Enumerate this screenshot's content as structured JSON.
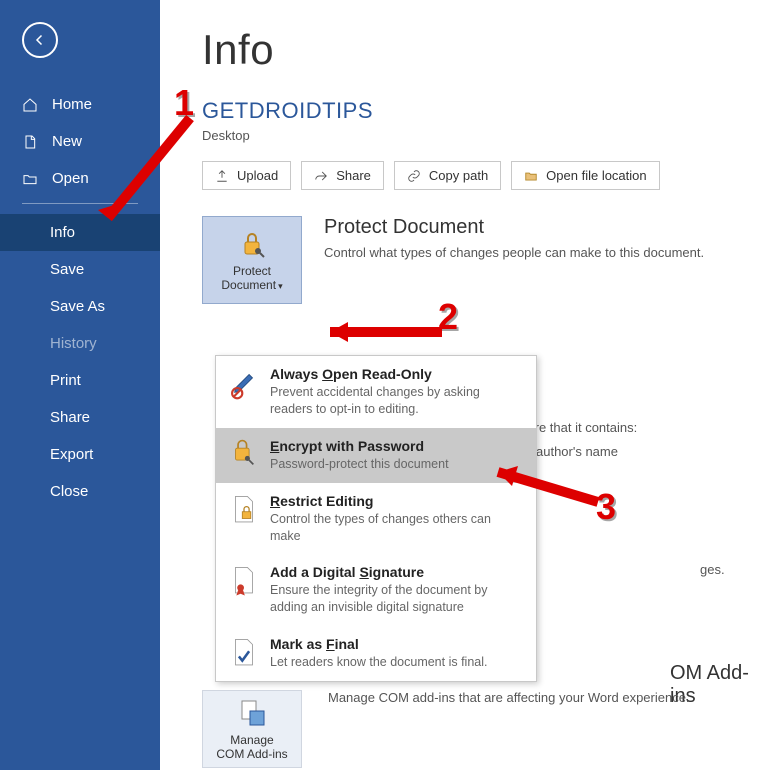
{
  "sidebar": {
    "items": [
      {
        "label": "Home",
        "icon": "home"
      },
      {
        "label": "New",
        "icon": "doc"
      },
      {
        "label": "Open",
        "icon": "folder"
      }
    ],
    "items2": [
      {
        "label": "Info",
        "selected": true
      },
      {
        "label": "Save"
      },
      {
        "label": "Save As"
      },
      {
        "label": "History",
        "disabled": true
      },
      {
        "label": "Print"
      },
      {
        "label": "Share"
      },
      {
        "label": "Export"
      },
      {
        "label": "Close"
      }
    ]
  },
  "page": {
    "title": "Info",
    "docTitle": "GETDROIDTIPS",
    "docLocation": "Desktop"
  },
  "toolbar": {
    "upload": "Upload",
    "share": "Share",
    "copy": "Copy path",
    "openloc": "Open file location"
  },
  "protect": {
    "btn_l1": "Protect",
    "btn_l2": "Document",
    "heading": "Protect Document",
    "desc": "Control what types of changes people can make to this document."
  },
  "inspect": {
    "heading_partial": "ware that it contains:",
    "bullet1": "author's name"
  },
  "addins": {
    "heading_fragment": "OM Add-ins",
    "desc_fragment": "Manage COM add-ins that are affecting your Word experience.",
    "btn_l1": "Manage",
    "btn_l2": "COM Add-ins"
  },
  "changes_fragment": "ges.",
  "dropdown": [
    {
      "title": "Always Open Read-Only",
      "desc": "Prevent accidental changes by asking readers to opt-in to editing.",
      "u": 7
    },
    {
      "title": "Encrypt with Password",
      "desc": "Password-protect this document",
      "hover": true,
      "u": 0
    },
    {
      "title": "Restrict Editing",
      "desc": "Control the types of changes others can make",
      "u": 0
    },
    {
      "title": "Add a Digital Signature",
      "desc": "Ensure the integrity of the document by adding an invisible digital signature",
      "u": 14
    },
    {
      "title": "Mark as Final",
      "desc": "Let readers know the document is final.",
      "u": 8
    }
  ],
  "annotations": {
    "n1": "1",
    "n2": "2",
    "n3": "3"
  }
}
